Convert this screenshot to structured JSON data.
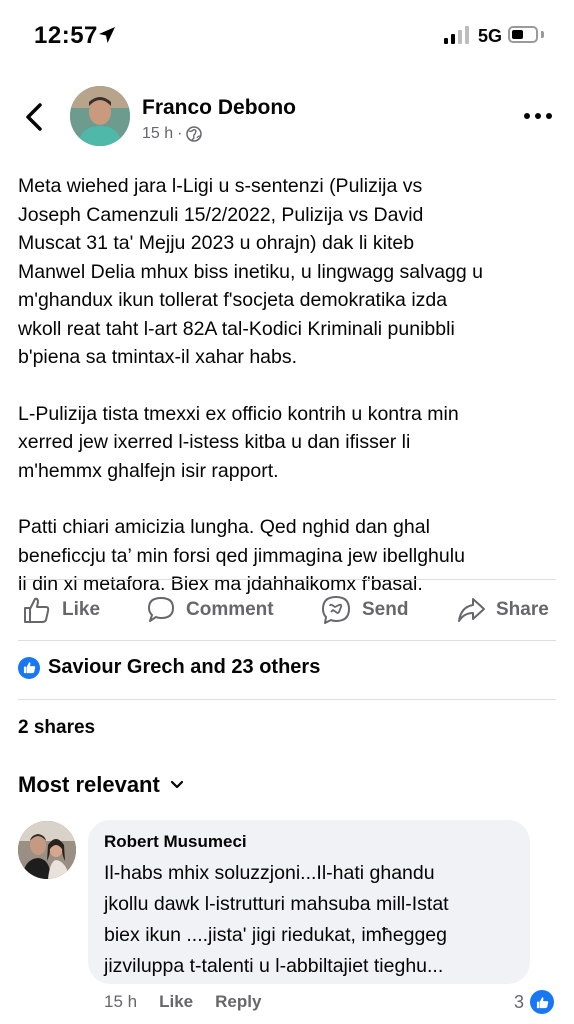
{
  "status_bar": {
    "time": "12:57",
    "network": "5G",
    "signal_bars_active": 2,
    "battery_level": 0.5
  },
  "post": {
    "author": "Franco Debono",
    "time_ago": "15 h",
    "separator": "·",
    "privacy_icon": "globe-icon",
    "paragraphs": [
      "Meta wiehed jara l-Ligi u s-sentenzi (Pulizija  vs\nJoseph Camenzuli 15/2/2022, Pulizija vs David\nMuscat 31 ta' Mejju 2023 u ohrajn) dak li kiteb\nManwel Delia mhux biss inetiku, u lingwagg salvagg u\nm'ghandux ikun  tollerat f'socjeta demokratika izda\nwkoll reat taht l-art 82A tal-Kodici Kriminali punibbli\nb'piena sa tmintax-il xahar habs.",
      "L-Pulizija tista tmexxi ex officio kontrih u kontra min\nxerred jew ixerred l-istess kitba u dan ifisser li\nm'hemmx ghalfejn isir rapport.",
      "Patti chiari amicizia lungha. Qed nghid dan ghal\nbeneficcju ta’ min forsi qed jimmagina jew ibellghulu\nli din xi metafora. Biex ma jdahhalkomx f'basal."
    ]
  },
  "actions": {
    "like": "Like",
    "comment": "Comment",
    "send": "Send",
    "share": "Share"
  },
  "reactions": {
    "text": "Saviour Grech and 23 others"
  },
  "shares": "2 shares",
  "sort": {
    "label": "Most relevant"
  },
  "comment": {
    "author": "Robert Musumeci",
    "text": "Il-habs mhix soluzzjoni...Il-hati ghandu\njkollu dawk l-istrutturi mahsuba mill-Istat\nbiex ikun ....jista' jigi riedukat, imħeggeg\njizviluppa t-talenti u l-abbiltajiet tieghu...",
    "time_ago": "15 h",
    "like_label": "Like",
    "reply_label": "Reply",
    "reaction_count": "3"
  },
  "colors": {
    "accent": "#1877f2",
    "secondary_text": "#65676b",
    "bubble": "#f0f2f5"
  }
}
